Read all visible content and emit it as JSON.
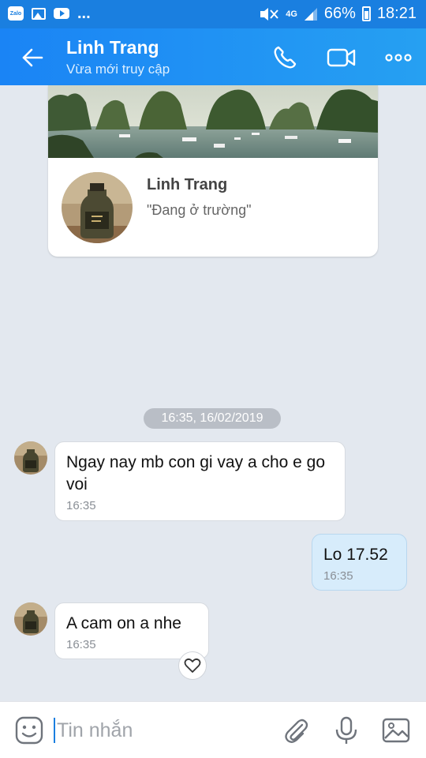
{
  "status_bar": {
    "app_icon_text": "Zalo",
    "more": "...",
    "network": "4G",
    "battery": "66%",
    "time": "18:21"
  },
  "header": {
    "contact_name": "Linh Trang",
    "contact_status": "Vừa mới truy cập"
  },
  "profile_card": {
    "name": "Linh Trang",
    "quote": "\"Đang ở trường\""
  },
  "date_separator": "16:35, 16/02/2019",
  "messages": [
    {
      "direction": "in",
      "text": "Ngay nay mb con gi vay a cho e go voi",
      "time": "16:35"
    },
    {
      "direction": "out",
      "text": "Lo 17.52",
      "time": "16:35"
    },
    {
      "direction": "in",
      "text": "A cam on a nhe",
      "time": "16:35"
    }
  ],
  "input": {
    "placeholder": "Tin nhắn"
  },
  "colors": {
    "header": "#1a84f5",
    "background": "#e3e8ef",
    "outgoing_bubble": "#d7ecfb",
    "accent": "#1a7fe0"
  }
}
